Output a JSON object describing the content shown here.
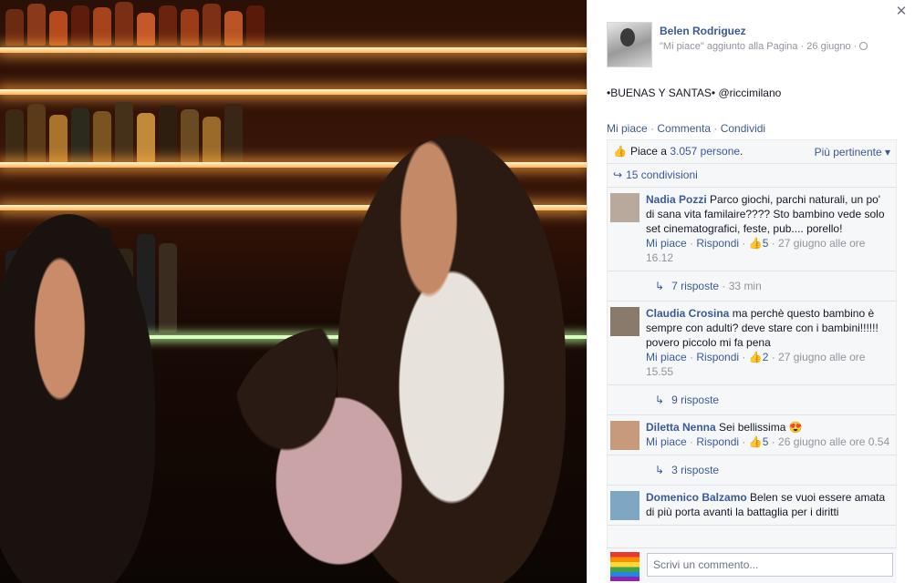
{
  "post": {
    "author": "Belen Rodriguez",
    "subline": "\"Mi piace\" aggiunto alla Pagina · 26 giugno ·",
    "text": "•BUENAS Y SANTAS• @riccimilano",
    "actions": {
      "like": "Mi piace",
      "sep1": " · ",
      "comment": "Commenta",
      "sep2": " · ",
      "share": "Condividi"
    }
  },
  "likes": {
    "prefix": "Piace a ",
    "count_link": "3.057 persone",
    "suffix": ".",
    "sort_label": "Più pertinente ▾"
  },
  "shares": {
    "label": "15 condivisioni"
  },
  "comments": [
    {
      "author": "Nadia Pozzi",
      "text": " Parco giochi, parchi naturali, un po' di sana vita familaire???? Sto bambino vede solo set cinematografici, feste, pub.... porello!",
      "like": "Mi piace",
      "reply": "Rispondi",
      "likes": "5",
      "time": "27 giugno alle ore 16.12",
      "replies": "7 risposte",
      "replies_time": " · 33 min",
      "avatar_color": "#b9a89c"
    },
    {
      "author": "Claudia Crosina",
      "text": " ma perchè questo bambino è sempre con adulti? deve stare con i bambini!!!!!! povero piccolo mi fa pena",
      "like": "Mi piace",
      "reply": "Rispondi",
      "likes": "2",
      "time": "27 giugno alle ore 15.55",
      "replies": "9 risposte",
      "replies_time": "",
      "avatar_color": "#8a7a6c"
    },
    {
      "author": "Diletta Nenna",
      "text": " Sei bellissima 😍",
      "like": "Mi piace",
      "reply": "Rispondi",
      "likes": "5",
      "time": "26 giugno alle ore 0.54",
      "replies": "3 risposte",
      "replies_time": "",
      "avatar_color": "#c69a7a"
    },
    {
      "author": "Domenico Balzamo",
      "text": " Belen se vuoi essere amata di più porta avanti la battaglia per i diritti",
      "avatar_color": "#7fa6c2"
    }
  ],
  "composer": {
    "placeholder": "Scrivi un commento..."
  },
  "close_label": "✕",
  "colors": {
    "link": "#3b5998",
    "muted": "#90949c",
    "panel": "#f6f7f9"
  }
}
